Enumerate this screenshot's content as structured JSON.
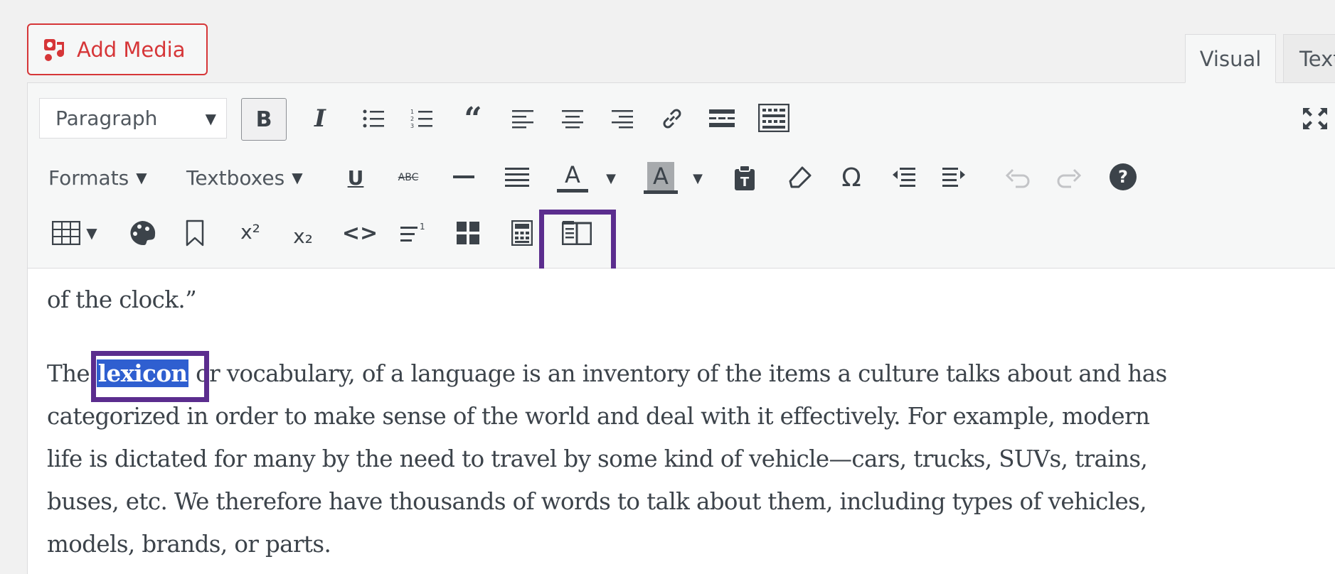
{
  "media": {
    "add_media_label": "Add Media"
  },
  "tabs": {
    "visual": "Visual",
    "text": "Text"
  },
  "toolbar": {
    "format_select": "Paragraph",
    "bold_label": "B",
    "italic_label": "I",
    "formats_menu": "Formats",
    "textboxes_menu": "Textboxes",
    "underline_label": "U",
    "strike_label": "ABC",
    "text_color_label": "A",
    "bg_color_label": "A",
    "omega_label": "Ω",
    "superscript_label": "x²",
    "subscript_label": "x₂",
    "code_label": "<>",
    "help_label": "?"
  },
  "content": {
    "line_top": "of the clock.”",
    "para_before": "The ",
    "selected_word": "lexicon",
    "para_after_line1": " or vocabulary, of a language is an inventory of the items a culture talks about and has",
    "line2": "categorized in order to make sense of the world and deal with it effectively. For example, modern",
    "line3": "life is dictated for many by the need to travel by some kind of vehicle—cars, trucks, SUVs, trains,",
    "line4": "buses, etc. We therefore have thousands of words to talk about them, including types of vehicles,",
    "line5": "models, brands, or parts."
  },
  "colors": {
    "accent_red": "#d63638",
    "highlight_purple": "#5b2d8e",
    "selection_blue": "#2f5fd0"
  }
}
